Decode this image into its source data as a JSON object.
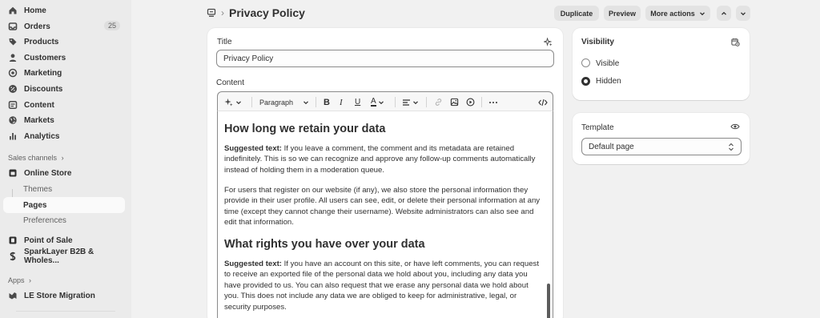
{
  "sidebar": {
    "nav": [
      {
        "label": "Home",
        "icon": "home-icon"
      },
      {
        "label": "Orders",
        "icon": "inbox-icon",
        "badge": "25"
      },
      {
        "label": "Products",
        "icon": "tag-icon"
      },
      {
        "label": "Customers",
        "icon": "person-icon"
      },
      {
        "label": "Marketing",
        "icon": "target-icon"
      },
      {
        "label": "Discounts",
        "icon": "discount-icon"
      },
      {
        "label": "Content",
        "icon": "content-icon"
      },
      {
        "label": "Markets",
        "icon": "globe-icon"
      },
      {
        "label": "Analytics",
        "icon": "bar-chart-icon"
      }
    ],
    "sales_channels_label": "Sales channels",
    "online_store": "Online Store",
    "sub_items": [
      "Themes",
      "Pages",
      "Preferences"
    ],
    "point_of_sale": "Point of Sale",
    "sparklayer": "SparkLayer B2B & Wholes...",
    "apps_label": "Apps",
    "le_store": "LE Store Migration"
  },
  "header": {
    "title": "Privacy Policy",
    "duplicate": "Duplicate",
    "preview": "Preview",
    "more_actions": "More actions"
  },
  "form": {
    "title_label": "Title",
    "title_value": "Privacy Policy",
    "content_label": "Content",
    "paragraph_style": "Paragraph"
  },
  "content": {
    "h1": "How long we retain your data",
    "p1_bold": "Suggested text:",
    "p1": " If you leave a comment, the comment and its metadata are retained indefinitely. This is so we can recognize and approve any follow-up comments automatically instead of holding them in a moderation queue.",
    "p2": "For users that register on our website (if any), we also store the personal information they provide in their user profile. All users can see, edit, or delete their personal information at any time (except they cannot change their username). Website administrators can also see and edit that information.",
    "h2": "What rights you have over your data",
    "p3_bold": "Suggested text:",
    "p3": " If you have an account on this site, or have left comments, you can request to receive an exported file of the personal data we hold about you, including any data you have provided to us. You can also request that we erase any personal data we hold about you. This does not include any data we are obliged to keep for administrative, legal, or security purposes."
  },
  "visibility": {
    "title": "Visibility",
    "options": [
      "Visible",
      "Hidden"
    ],
    "selected": "Hidden"
  },
  "template": {
    "title": "Template",
    "value": "Default page"
  }
}
